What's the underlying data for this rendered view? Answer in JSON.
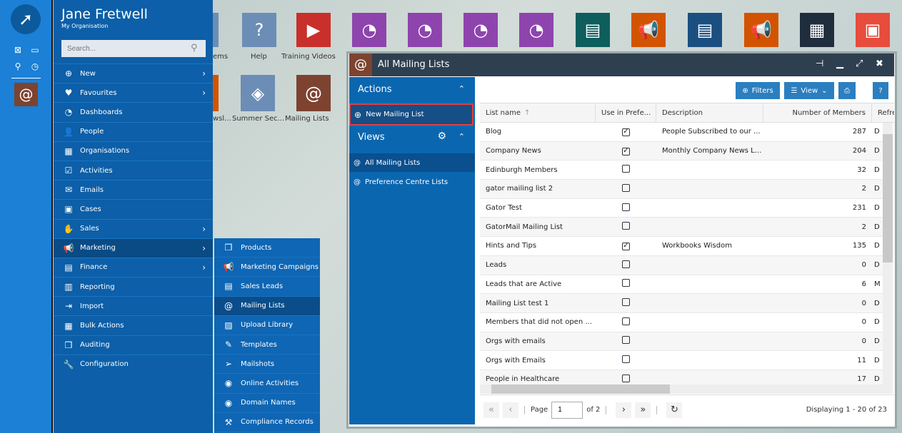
{
  "user": {
    "name": "Jane Fretwell",
    "org": "My Organisation"
  },
  "search": {
    "placeholder": "Search..."
  },
  "menu": [
    {
      "label": "New",
      "icon": "plus-circle-icon",
      "chevron": true
    },
    {
      "label": "Favourites",
      "icon": "heart-icon",
      "chevron": true
    },
    {
      "label": "Dashboards",
      "icon": "dashboard-icon"
    },
    {
      "label": "People",
      "icon": "person-icon"
    },
    {
      "label": "Organisations",
      "icon": "building-icon"
    },
    {
      "label": "Activities",
      "icon": "clipboard-icon"
    },
    {
      "label": "Emails",
      "icon": "envelope-icon"
    },
    {
      "label": "Cases",
      "icon": "briefcase-icon"
    },
    {
      "label": "Sales",
      "icon": "handshake-icon",
      "chevron": true
    },
    {
      "label": "Marketing",
      "icon": "megaphone-icon",
      "chevron": true,
      "active": true
    },
    {
      "label": "Finance",
      "icon": "wallet-icon",
      "chevron": true
    },
    {
      "label": "Reporting",
      "icon": "bar-chart-icon"
    },
    {
      "label": "Import",
      "icon": "import-icon"
    },
    {
      "label": "Bulk Actions",
      "icon": "grid-icon"
    },
    {
      "label": "Auditing",
      "icon": "cubes-icon"
    },
    {
      "label": "Configuration",
      "icon": "wrench-icon"
    }
  ],
  "submenu": [
    {
      "label": "Products",
      "icon": "cube-icon"
    },
    {
      "label": "Marketing Campaigns",
      "icon": "megaphone-icon"
    },
    {
      "label": "Sales Leads",
      "icon": "id-card-icon"
    },
    {
      "label": "Mailing Lists",
      "icon": "at-icon",
      "active": true
    },
    {
      "label": "Upload Library",
      "icon": "image-icon"
    },
    {
      "label": "Templates",
      "icon": "edit-icon"
    },
    {
      "label": "Mailshots",
      "icon": "paper-plane-icon"
    },
    {
      "label": "Online Activities",
      "icon": "globe-icon"
    },
    {
      "label": "Domain Names",
      "icon": "globe-icon"
    },
    {
      "label": "Compliance Records",
      "icon": "gavel-icon"
    }
  ],
  "desktop": {
    "row1": [
      {
        "label": "ems",
        "color": "#6c8db5"
      },
      {
        "label": "Help",
        "color": "#6c8db5"
      },
      {
        "label": "Training Videos",
        "color": "#c9302c"
      },
      {
        "label": "",
        "color": "#8e44ad"
      },
      {
        "label": "",
        "color": "#8e44ad"
      },
      {
        "label": "",
        "color": "#8e44ad"
      },
      {
        "label": "",
        "color": "#8e44ad"
      },
      {
        "label": "",
        "color": "#0e5e5e"
      },
      {
        "label": "",
        "color": "#d35400"
      },
      {
        "label": "",
        "color": "#1b4f80"
      },
      {
        "label": "",
        "color": "#d35400"
      },
      {
        "label": "",
        "color": "#1f2d3d"
      },
      {
        "label": "",
        "color": "#e74c3c"
      }
    ],
    "row2": [
      {
        "label": "wsl...",
        "color": "#d35400"
      },
      {
        "label": "Summer Sec...",
        "color": "#6c8db5"
      },
      {
        "label": "Mailing Lists",
        "color": "#7d4330"
      }
    ]
  },
  "window": {
    "title": "All Mailing Lists",
    "actions_header": "Actions",
    "new_button": "New Mailing List",
    "views_header": "Views",
    "views": [
      {
        "label": "All Mailing Lists",
        "active": true
      },
      {
        "label": "Preference Centre Lists"
      }
    ],
    "toolbar": {
      "filters": "Filters",
      "view": "View"
    },
    "columns": [
      "List name",
      "Use in Prefe...",
      "Description",
      "Number of Members",
      "Refre"
    ],
    "rows": [
      {
        "name": "Blog",
        "pref": true,
        "desc": "People Subscribed to our ...",
        "members": "287",
        "r": "D"
      },
      {
        "name": "Company News",
        "pref": true,
        "desc": "Monthly Company News L...",
        "members": "204",
        "r": "D"
      },
      {
        "name": "Edinburgh Members",
        "pref": false,
        "desc": "",
        "members": "32",
        "r": "D"
      },
      {
        "name": "gator mailing list 2",
        "pref": false,
        "desc": "",
        "members": "2",
        "r": "D"
      },
      {
        "name": "Gator Test",
        "pref": false,
        "desc": "",
        "members": "231",
        "r": "D"
      },
      {
        "name": "GatorMail Mailing List",
        "pref": false,
        "desc": "",
        "members": "2",
        "r": "D"
      },
      {
        "name": "Hints and Tips",
        "pref": true,
        "desc": "Workbooks Wisdom",
        "members": "135",
        "r": "D"
      },
      {
        "name": "Leads",
        "pref": false,
        "desc": "",
        "members": "0",
        "r": "D"
      },
      {
        "name": "Leads that are Active",
        "pref": false,
        "desc": "",
        "members": "6",
        "r": "M"
      },
      {
        "name": "Mailing List test 1",
        "pref": false,
        "desc": "",
        "members": "0",
        "r": "D"
      },
      {
        "name": "Members that did not open ...",
        "pref": false,
        "desc": "",
        "members": "0",
        "r": "D"
      },
      {
        "name": "Orgs with emails",
        "pref": false,
        "desc": "",
        "members": "0",
        "r": "D"
      },
      {
        "name": "Orgs with Emails",
        "pref": false,
        "desc": "",
        "members": "11",
        "r": "D"
      },
      {
        "name": "People in Healthcare",
        "pref": false,
        "desc": "",
        "members": "17",
        "r": "D"
      }
    ],
    "pager": {
      "page_label": "Page",
      "page": "1",
      "of": "of 2",
      "displaying": "Displaying 1 - 20 of 23"
    }
  }
}
